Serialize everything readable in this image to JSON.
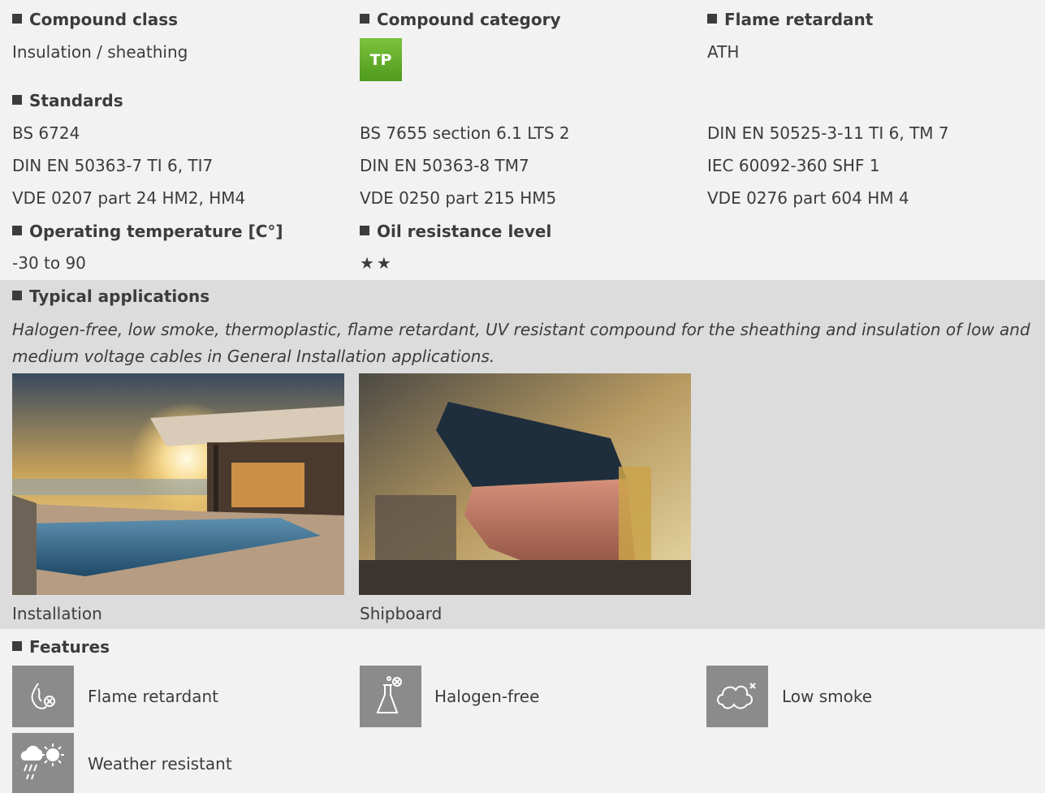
{
  "sections": {
    "compound_class": {
      "heading": "Compound class",
      "value": "Insulation / sheathing"
    },
    "compound_category": {
      "heading": "Compound category",
      "badge": "TP"
    },
    "flame_retardant": {
      "heading": "Flame retardant",
      "value": "ATH"
    },
    "standards": {
      "heading": "Standards",
      "items": [
        "BS 6724",
        "BS 7655 section 6.1 LTS 2",
        "DIN EN 50525-3-11 TI 6, TM 7",
        "DIN EN 50363-7 TI 6, TI7",
        "DIN EN 50363-8 TM7",
        "IEC 60092-360 SHF 1",
        "VDE 0207 part 24 HM2, HM4",
        "VDE 0250 part 215 HM5",
        "VDE 0276 part 604 HM 4"
      ]
    },
    "operating_temperature": {
      "heading": "Operating temperature [C°]",
      "value": "-30 to 90"
    },
    "oil_resistance": {
      "heading": "Oil resistance level",
      "value": "★★"
    },
    "typical_applications": {
      "heading": "Typical applications",
      "description": "Halogen-free, low smoke, thermoplastic, flame retardant, UV resistant compound for the sheathing and insulation of low and medium voltage cables in General Installation applications.",
      "images": [
        {
          "caption": "Installation"
        },
        {
          "caption": "Shipboard"
        }
      ]
    },
    "features": {
      "heading": "Features",
      "items": [
        {
          "label": "Flame retardant",
          "icon": "flame-retardant-icon"
        },
        {
          "label": "Halogen-free",
          "icon": "flask-icon"
        },
        {
          "label": "Low smoke",
          "icon": "smoke-cloud-icon"
        },
        {
          "label": "Weather resistant",
          "icon": "weather-icon"
        }
      ]
    }
  },
  "colors": {
    "badge_green": "#5aab25",
    "icon_gray": "#8b8b8b",
    "band_gray": "#dcdcdc",
    "page_bg": "#f2f2f2"
  }
}
